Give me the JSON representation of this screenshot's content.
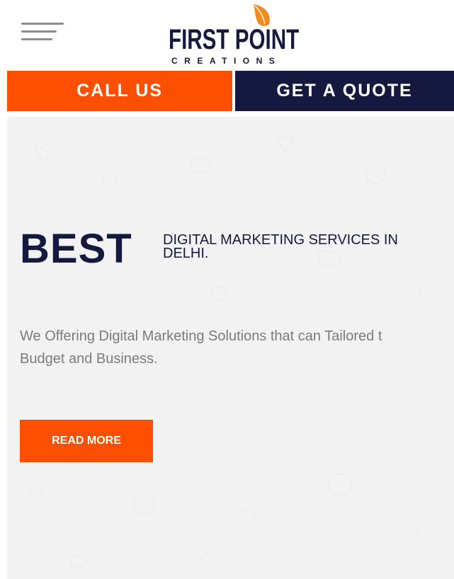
{
  "header": {
    "menu_icon": "hamburger-menu-icon",
    "logo": {
      "main": "FIRST POINT",
      "sub": "CREATIONS",
      "leaf_color": "#f28a1b"
    }
  },
  "cta": {
    "call_label": "CALL US",
    "quote_label": "GET A QUOTE",
    "call_color": "#fd4f00",
    "quote_color": "#16193f"
  },
  "hero": {
    "best": "BEST",
    "subtitle": "DIGITAL MARKETING SERVICES IN DELHI.",
    "description": "We Offering Digital Marketing Solutions that can Tailored t\nBudget and Business.",
    "read_more": "READ MORE",
    "background": "#f2f2f2"
  }
}
